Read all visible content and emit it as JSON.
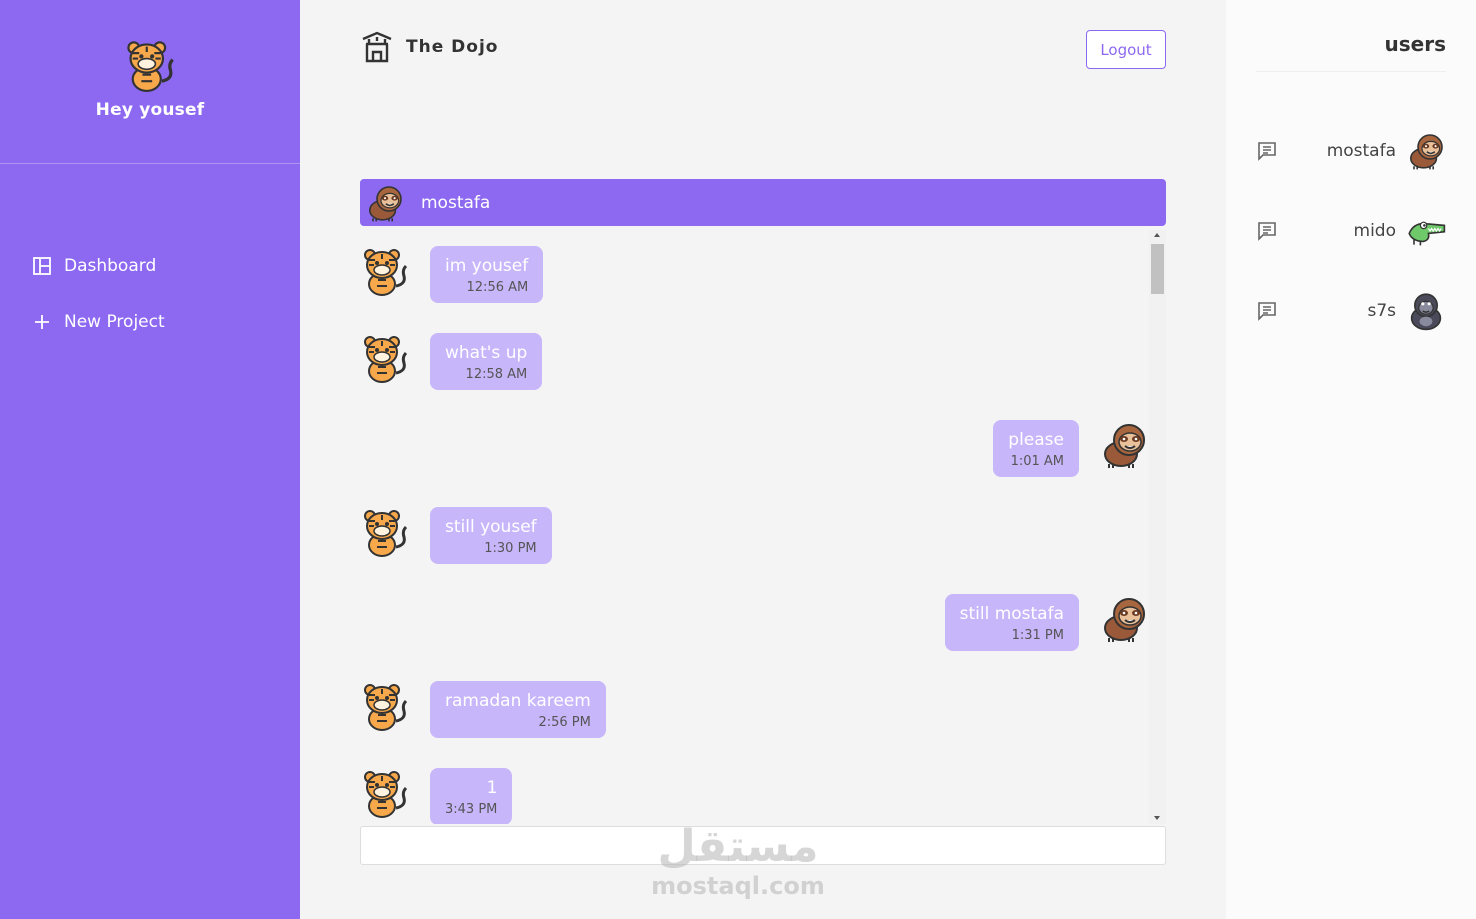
{
  "sidebar": {
    "greeting": "Hey yousef",
    "nav": [
      {
        "label": "Dashboard",
        "icon": "dashboard-icon"
      },
      {
        "label": "New Project",
        "icon": "plus-icon"
      }
    ]
  },
  "header": {
    "brand": "The Dojo",
    "logout": "Logout"
  },
  "chat": {
    "partner": "mostafa",
    "messages": [
      {
        "text": "im yousef",
        "time": "12:56 AM",
        "side": "left"
      },
      {
        "text": "what's up",
        "time": "12:58 AM",
        "side": "left"
      },
      {
        "text": "please",
        "time": "1:01 AM",
        "side": "right"
      },
      {
        "text": "still yousef",
        "time": "1:30 PM",
        "side": "left"
      },
      {
        "text": "still mostafa",
        "time": "1:31 PM",
        "side": "right"
      },
      {
        "text": "ramadan kareem",
        "time": "2:56 PM",
        "side": "left"
      },
      {
        "text": "1",
        "time": "3:43 PM",
        "side": "left"
      }
    ],
    "input_value": ""
  },
  "users": {
    "title": "users",
    "list": [
      {
        "name": "mostafa",
        "avatar": "sloth-avatar"
      },
      {
        "name": "mido",
        "avatar": "crocodile-avatar"
      },
      {
        "name": "s7s",
        "avatar": "gorilla-avatar"
      }
    ]
  },
  "watermark": {
    "arabic": "مستقل",
    "latin": "mostaql.com"
  },
  "colors": {
    "primary": "#8d69f1",
    "bubble": "#c8b6fb"
  }
}
